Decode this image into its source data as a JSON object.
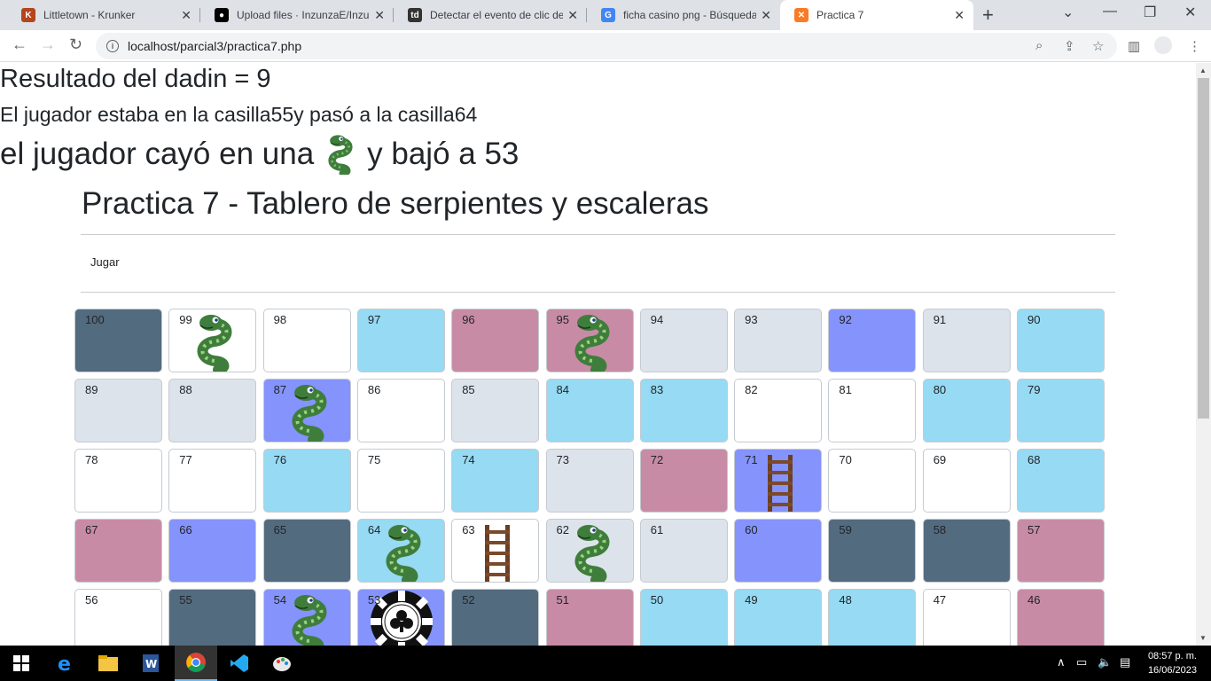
{
  "browser": {
    "tabs": [
      {
        "title": "Littletown - Krunker",
        "favicon": "krunker-icon",
        "color": "#b4451c"
      },
      {
        "title": "Upload files · InzunzaE/Inzunza",
        "favicon": "github-icon",
        "color": "#000000"
      },
      {
        "title": "Detectar el evento de clic del…",
        "favicon": "td-icon",
        "color": "#333333"
      },
      {
        "title": "ficha casino png - Búsqueda de…",
        "favicon": "google-icon",
        "color": "#4285f4"
      },
      {
        "title": "Practica 7",
        "favicon": "xampp-icon",
        "color": "#fb7a24"
      }
    ],
    "url": "localhost/parcial3/practica7.php"
  },
  "page": {
    "result": "Resultado del dadin = 9",
    "move": "El jugador estaba en la casilla55y pasó a la casilla64",
    "snake_prefix": "el jugador cayó en una",
    "snake_suffix": "y bajó a 53",
    "title": "Practica 7 - Tablero de serpientes y escaleras",
    "jugar": "Jugar"
  },
  "board": {
    "rows": [
      [
        {
          "n": "100",
          "color": "#536b7f",
          "pic": ""
        },
        {
          "n": "99",
          "color": "#ffffff",
          "pic": "snake"
        },
        {
          "n": "98",
          "color": "#ffffff",
          "pic": ""
        },
        {
          "n": "97",
          "color": "#96daf3",
          "pic": ""
        },
        {
          "n": "96",
          "color": "#c88ba5",
          "pic": ""
        },
        {
          "n": "95",
          "color": "#c88ba5",
          "pic": "snake"
        },
        {
          "n": "94",
          "color": "#dde3ea",
          "pic": ""
        },
        {
          "n": "93",
          "color": "#dde3ea",
          "pic": ""
        },
        {
          "n": "92",
          "color": "#8593fc",
          "pic": ""
        },
        {
          "n": "91",
          "color": "#dde3ea",
          "pic": ""
        },
        {
          "n": "90",
          "color": "#96daf3",
          "pic": ""
        }
      ],
      [
        {
          "n": "89",
          "color": "#dde3ea",
          "pic": ""
        },
        {
          "n": "88",
          "color": "#dde3ea",
          "pic": ""
        },
        {
          "n": "87",
          "color": "#8593fc",
          "pic": "snake"
        },
        {
          "n": "86",
          "color": "#ffffff",
          "pic": ""
        },
        {
          "n": "85",
          "color": "#dde3ea",
          "pic": ""
        },
        {
          "n": "84",
          "color": "#96daf3",
          "pic": ""
        },
        {
          "n": "83",
          "color": "#96daf3",
          "pic": ""
        },
        {
          "n": "82",
          "color": "#ffffff",
          "pic": ""
        },
        {
          "n": "81",
          "color": "#ffffff",
          "pic": ""
        },
        {
          "n": "80",
          "color": "#96daf3",
          "pic": ""
        },
        {
          "n": "79",
          "color": "#96daf3",
          "pic": ""
        }
      ],
      [
        {
          "n": "78",
          "color": "#ffffff",
          "pic": ""
        },
        {
          "n": "77",
          "color": "#ffffff",
          "pic": ""
        },
        {
          "n": "76",
          "color": "#96daf3",
          "pic": ""
        },
        {
          "n": "75",
          "color": "#ffffff",
          "pic": ""
        },
        {
          "n": "74",
          "color": "#96daf3",
          "pic": ""
        },
        {
          "n": "73",
          "color": "#dde3ea",
          "pic": ""
        },
        {
          "n": "72",
          "color": "#c88ba5",
          "pic": ""
        },
        {
          "n": "71",
          "color": "#8593fc",
          "pic": "ladder"
        },
        {
          "n": "70",
          "color": "#ffffff",
          "pic": ""
        },
        {
          "n": "69",
          "color": "#ffffff",
          "pic": ""
        },
        {
          "n": "68",
          "color": "#96daf3",
          "pic": ""
        }
      ],
      [
        {
          "n": "67",
          "color": "#c88ba5",
          "pic": ""
        },
        {
          "n": "66",
          "color": "#8593fc",
          "pic": ""
        },
        {
          "n": "65",
          "color": "#536b7f",
          "pic": ""
        },
        {
          "n": "64",
          "color": "#96daf3",
          "pic": "snake"
        },
        {
          "n": "63",
          "color": "#ffffff",
          "pic": "ladder"
        },
        {
          "n": "62",
          "color": "#dde3ea",
          "pic": "snake"
        },
        {
          "n": "61",
          "color": "#dde3ea",
          "pic": ""
        },
        {
          "n": "60",
          "color": "#8593fc",
          "pic": ""
        },
        {
          "n": "59",
          "color": "#536b7f",
          "pic": ""
        },
        {
          "n": "58",
          "color": "#536b7f",
          "pic": ""
        },
        {
          "n": "57",
          "color": "#c88ba5",
          "pic": ""
        }
      ],
      [
        {
          "n": "56",
          "color": "#ffffff",
          "pic": ""
        },
        {
          "n": "55",
          "color": "#536b7f",
          "pic": ""
        },
        {
          "n": "54",
          "color": "#8593fc",
          "pic": "snake"
        },
        {
          "n": "53",
          "color": "#8593fc",
          "pic": "chip"
        },
        {
          "n": "52",
          "color": "#536b7f",
          "pic": ""
        },
        {
          "n": "51",
          "color": "#c88ba5",
          "pic": ""
        },
        {
          "n": "50",
          "color": "#96daf3",
          "pic": ""
        },
        {
          "n": "49",
          "color": "#96daf3",
          "pic": ""
        },
        {
          "n": "48",
          "color": "#96daf3",
          "pic": ""
        },
        {
          "n": "47",
          "color": "#ffffff",
          "pic": ""
        },
        {
          "n": "46",
          "color": "#c88ba5",
          "pic": ""
        }
      ]
    ]
  },
  "taskbar": {
    "items": [
      "start-icon",
      "edge-icon",
      "file-explorer-icon",
      "word-icon",
      "chrome-icon",
      "vscode-icon",
      "paint-icon"
    ],
    "time": "08:57 p. m.",
    "date": "16/06/2023"
  }
}
